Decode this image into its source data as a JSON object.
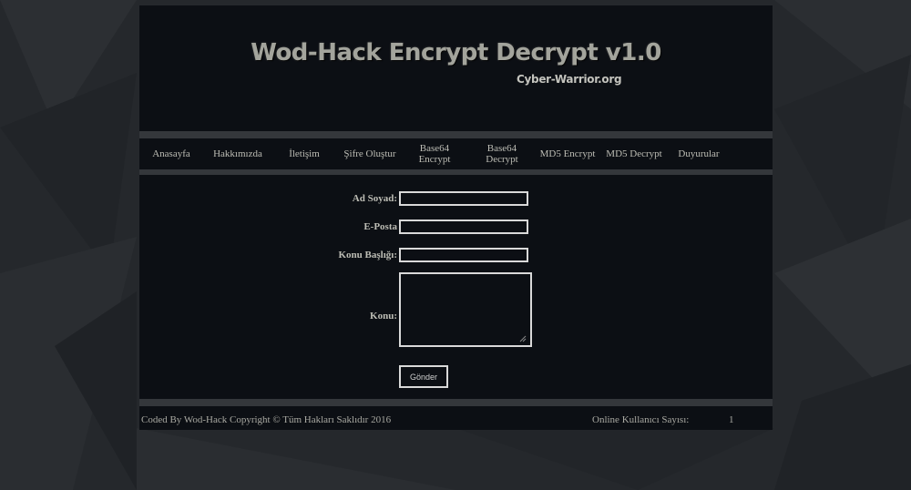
{
  "header": {
    "title": "Wod-Hack Encrypt Decrypt v1.0",
    "subtitle": "Cyber-Warrior.org"
  },
  "nav": {
    "items": [
      {
        "label": "Anasayfa"
      },
      {
        "label": "Hakkımızda"
      },
      {
        "label": "İletişim"
      },
      {
        "label": "Şifre Oluştur"
      },
      {
        "label": "Base64\nEncrypt"
      },
      {
        "label": "Base64\nDecrypt"
      },
      {
        "label": "MD5 Encrypt"
      },
      {
        "label": "MD5 Decrypt"
      },
      {
        "label": "Duyurular"
      }
    ]
  },
  "form": {
    "name_label": "Ad Soyad:",
    "name_value": "",
    "email_label": "E-Posta",
    "email_value": "",
    "subject_label": "Konu Başlığı:",
    "subject_value": "",
    "message_label": "Konu:",
    "message_value": "",
    "submit_label": "Gönder"
  },
  "footer": {
    "copyright": "Coded By Wod-Hack Copyright © Tüm Hakları Saklıdır 2016",
    "online_label": "Online Kullanıcı Sayısı:",
    "online_count": "1"
  },
  "colors": {
    "page_background": "#26292d",
    "panel_background": "#0c0f14",
    "separator": "#34373b",
    "text": "#bdbdb5",
    "input_border": "#d9d9d9"
  }
}
